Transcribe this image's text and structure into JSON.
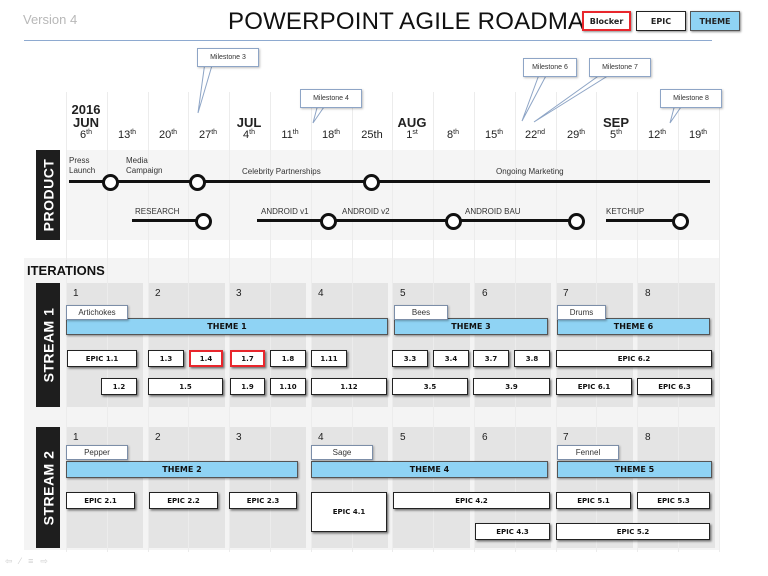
{
  "header": {
    "version": "Version 4",
    "title": "POWERPOINT AGILE ROADMAP",
    "legend": [
      {
        "label": "Blocker",
        "type": "blocker",
        "color": "#e8262c"
      },
      {
        "label": "EPIC",
        "type": "epic"
      },
      {
        "label": "THEME",
        "type": "theme",
        "color": "#8fd3f4"
      }
    ]
  },
  "timeline": {
    "year": "2016",
    "weeks": [
      {
        "month": "JUN",
        "day": "6",
        "suffix": "th",
        "showYear": true
      },
      {
        "month": "",
        "day": "13",
        "suffix": "th"
      },
      {
        "month": "",
        "day": "20",
        "suffix": "th"
      },
      {
        "month": "",
        "day": "27",
        "suffix": "th"
      },
      {
        "month": "JUL",
        "day": "4",
        "suffix": "th"
      },
      {
        "month": "",
        "day": "11",
        "suffix": "th"
      },
      {
        "month": "",
        "day": "18",
        "suffix": "th"
      },
      {
        "month": "",
        "day": "25th",
        "suffix": ""
      },
      {
        "month": "AUG",
        "day": "1",
        "suffix": "st"
      },
      {
        "month": "",
        "day": "8",
        "suffix": "th"
      },
      {
        "month": "",
        "day": "15",
        "suffix": "th"
      },
      {
        "month": "",
        "day": "22",
        "suffix": "nd"
      },
      {
        "month": "",
        "day": "29",
        "suffix": "th"
      },
      {
        "month": "SEP",
        "day": "5",
        "suffix": "th"
      },
      {
        "month": "",
        "day": "12",
        "suffix": "th"
      },
      {
        "month": "",
        "day": "19",
        "suffix": "th"
      }
    ],
    "milestones": [
      {
        "label": "Milestone 3",
        "week": 3
      },
      {
        "label": "Milestone 4",
        "week": 6
      },
      {
        "label": "Milestone 6",
        "week": 11
      },
      {
        "label": "Milestone 7",
        "week": 11
      },
      {
        "label": "Milestone 8",
        "week": 14
      }
    ]
  },
  "product": {
    "label": "PRODUCT",
    "marketing_track": {
      "labels": [
        "Press\nLaunch",
        "Media\nCampaign",
        "Celebrity Partnerships",
        "Ongoing Marketing"
      ],
      "label_parts": {
        "press1": "Press",
        "press2": "Launch",
        "media1": "Media",
        "media2": "Campaign"
      }
    },
    "dev_track": {
      "labels": [
        "RESEARCH",
        "ANDROID v1",
        "ANDROID v2",
        "ANDROID BAU",
        "KETCHUP"
      ]
    }
  },
  "iterations": {
    "title": "ITERATIONS",
    "numbers": [
      "1",
      "2",
      "3",
      "4",
      "5",
      "6",
      "7",
      "8"
    ],
    "streams": [
      {
        "label": "STREAM 1",
        "tags": [
          "Artichokes",
          "Bees",
          "Drums"
        ],
        "themes": [
          "THEME 1",
          "THEME 3",
          "THEME 6"
        ],
        "epics_row1": [
          "EPIC 1.1",
          "1.3",
          "1.4",
          "1.7",
          "1.8",
          "1.11",
          "3.3",
          "3.4",
          "3.7",
          "3.8",
          "EPIC 6.2"
        ],
        "epics_row2": [
          "1.2",
          "1.5",
          "1.9",
          "1.10",
          "1.12",
          "3.5",
          "3.9",
          "EPIC 6.1",
          "EPIC 6.3"
        ],
        "blockers": [
          "1.4",
          "1.7"
        ]
      },
      {
        "label": "STREAM 2",
        "tags": [
          "Pepper",
          "Sage",
          "Fennel"
        ],
        "themes": [
          "THEME 2",
          "THEME 4",
          "THEME 5"
        ],
        "epics_row1": [
          "EPIC 2.1",
          "EPIC 2.2",
          "EPIC 2.3",
          "EPIC 4.1",
          "EPIC 4.2",
          "EPIC 5.1",
          "EPIC 5.3"
        ],
        "epics_row2": [
          "EPIC 4.3",
          "EPIC 5.2"
        ]
      }
    ]
  },
  "footer": {
    "icons": [
      "back-arrow-icon",
      "pen-icon",
      "menu-icon",
      "forward-arrow-icon"
    ],
    "glyphs": "⇦ ⁄ ≡ ⇨"
  }
}
